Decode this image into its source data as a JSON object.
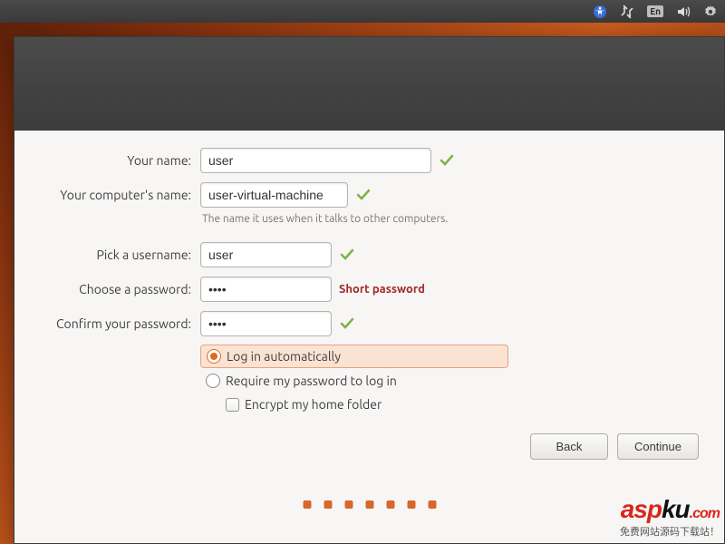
{
  "topbar": {
    "lang_badge": "En"
  },
  "form": {
    "your_name_label": "Your name:",
    "your_name_value": "user",
    "computer_name_label": "Your computer's name:",
    "computer_name_value": "user-virtual-machine",
    "computer_name_hint": "The name it uses when it talks to other computers.",
    "username_label": "Pick a username:",
    "username_value": "user",
    "password_label": "Choose a password:",
    "password_value": "••••",
    "password_warning": "Short password",
    "confirm_label": "Confirm your password:",
    "confirm_value": "••••",
    "radio_auto": "Log in automatically",
    "radio_require": "Require my password to log in",
    "check_encrypt": "Encrypt my home folder"
  },
  "buttons": {
    "back": "Back",
    "continue": "Continue"
  },
  "watermark": {
    "logo_left": "asp",
    "logo_right": "ku",
    "logo_suffix": ".com",
    "sub": "免费网站源码下载站！"
  }
}
